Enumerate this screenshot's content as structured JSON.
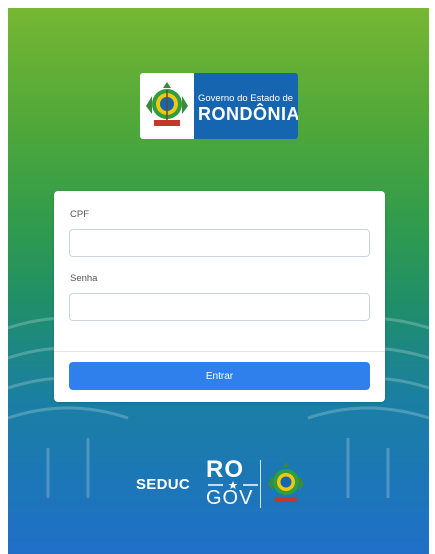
{
  "header": {
    "logo_line1": "Governo do Estado de",
    "logo_line2": "RONDÔNIA"
  },
  "form": {
    "cpf_label": "CPF",
    "cpf_value": "",
    "cpf_placeholder": "",
    "senha_label": "Senha",
    "senha_value": "",
    "senha_placeholder": "",
    "submit_label": "Entrar"
  },
  "footer": {
    "seduc": "SEDUC",
    "ro": "RO",
    "gov": "GOV"
  },
  "colors": {
    "primary_button": "#2f80ed",
    "logo_blue": "#1565b0",
    "gradient_top": "#76b733",
    "gradient_bottom": "#1f6fc8"
  },
  "icons": {
    "crest": "rondonia-coat-of-arms-icon"
  }
}
